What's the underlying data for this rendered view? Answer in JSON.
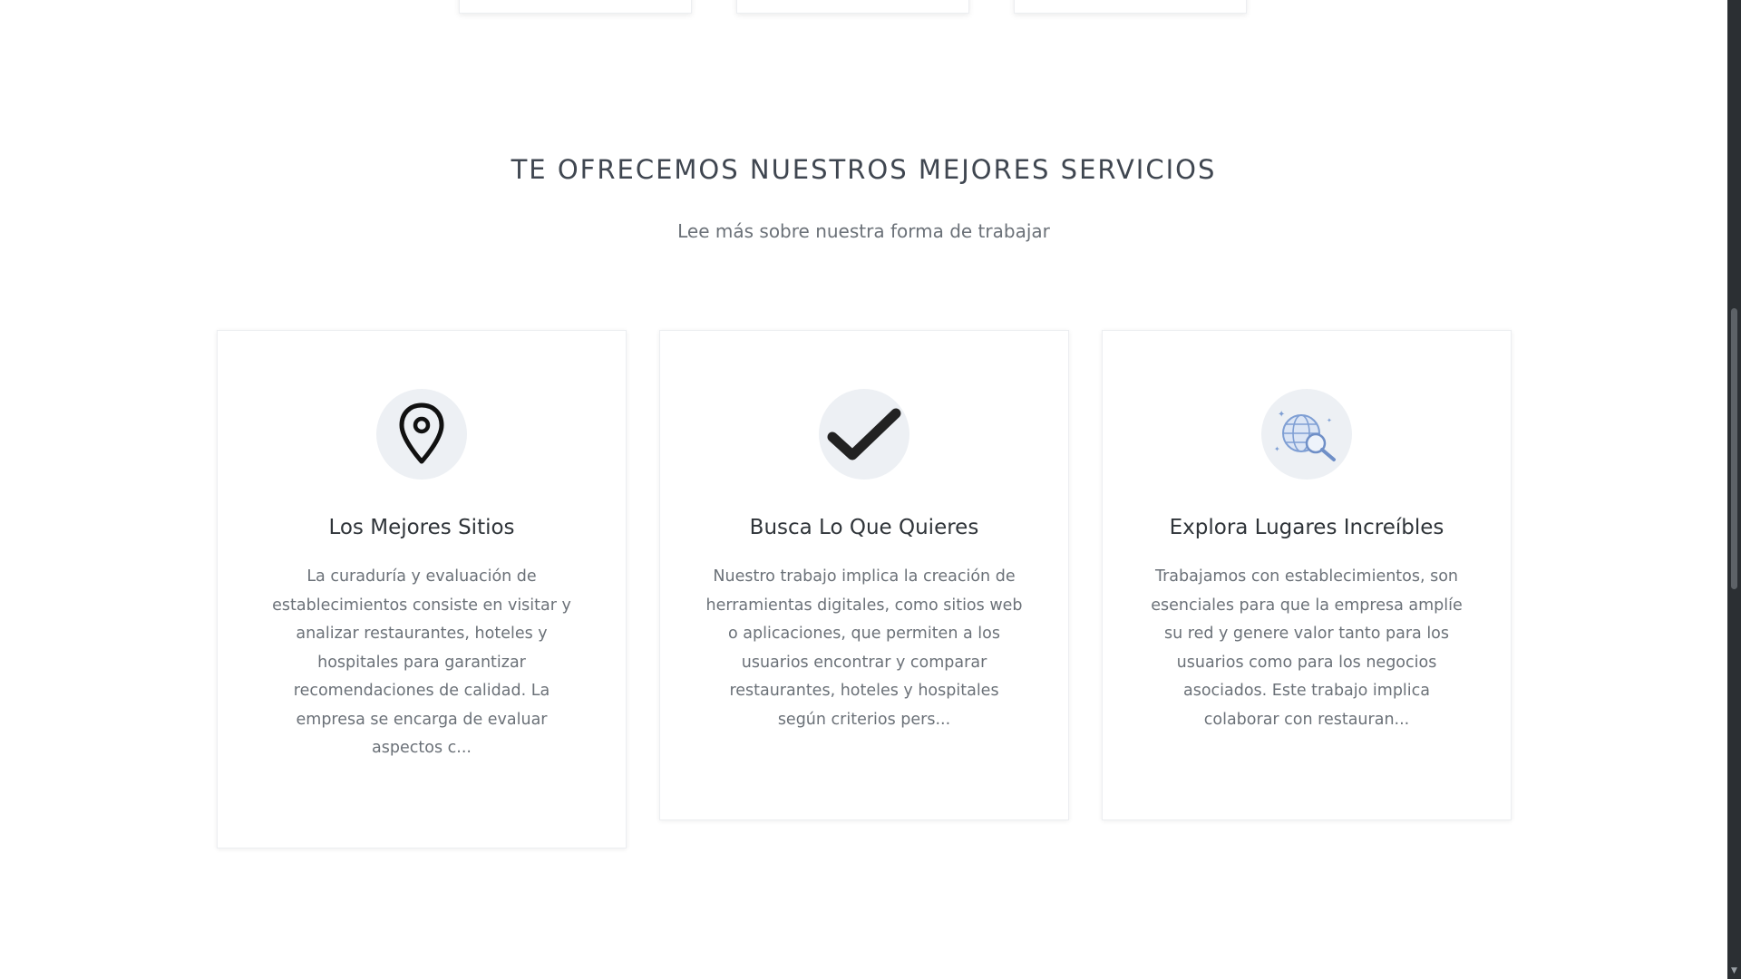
{
  "section": {
    "title": "TE OFRECEMOS NUESTROS MEJORES SERVICIOS",
    "subtitle": "Lee más sobre nuestra forma de trabajar"
  },
  "cards": [
    {
      "icon": "location-pin-icon",
      "title": "Los Mejores Sitios",
      "text": "La curaduría y evaluación de establecimientos consiste en visitar y analizar restaurantes, hoteles y hospitales para garantizar recomendaciones de calidad. La empresa se encarga de evaluar aspectos c..."
    },
    {
      "icon": "checkmark-icon",
      "title": "Busca Lo Que Quieres",
      "text": "Nuestro trabajo implica la creación de herramientas digitales, como sitios web o aplicaciones, que permiten a los usuarios encontrar y comparar restaurantes, hoteles y hospitales según criterios pers..."
    },
    {
      "icon": "globe-search-icon",
      "title": "Explora Lugares Increíbles",
      "text": "Trabajamos con establecimientos, son esenciales para que la empresa amplíe su red y genere valor tanto para los usuarios como para los negocios asociados. Este trabajo implica colaborar con restauran..."
    }
  ],
  "colors": {
    "icon_bg": "#edf0f4",
    "title": "#2f3439",
    "text": "#6b7178",
    "globe_accent": "#7f9fd4"
  }
}
